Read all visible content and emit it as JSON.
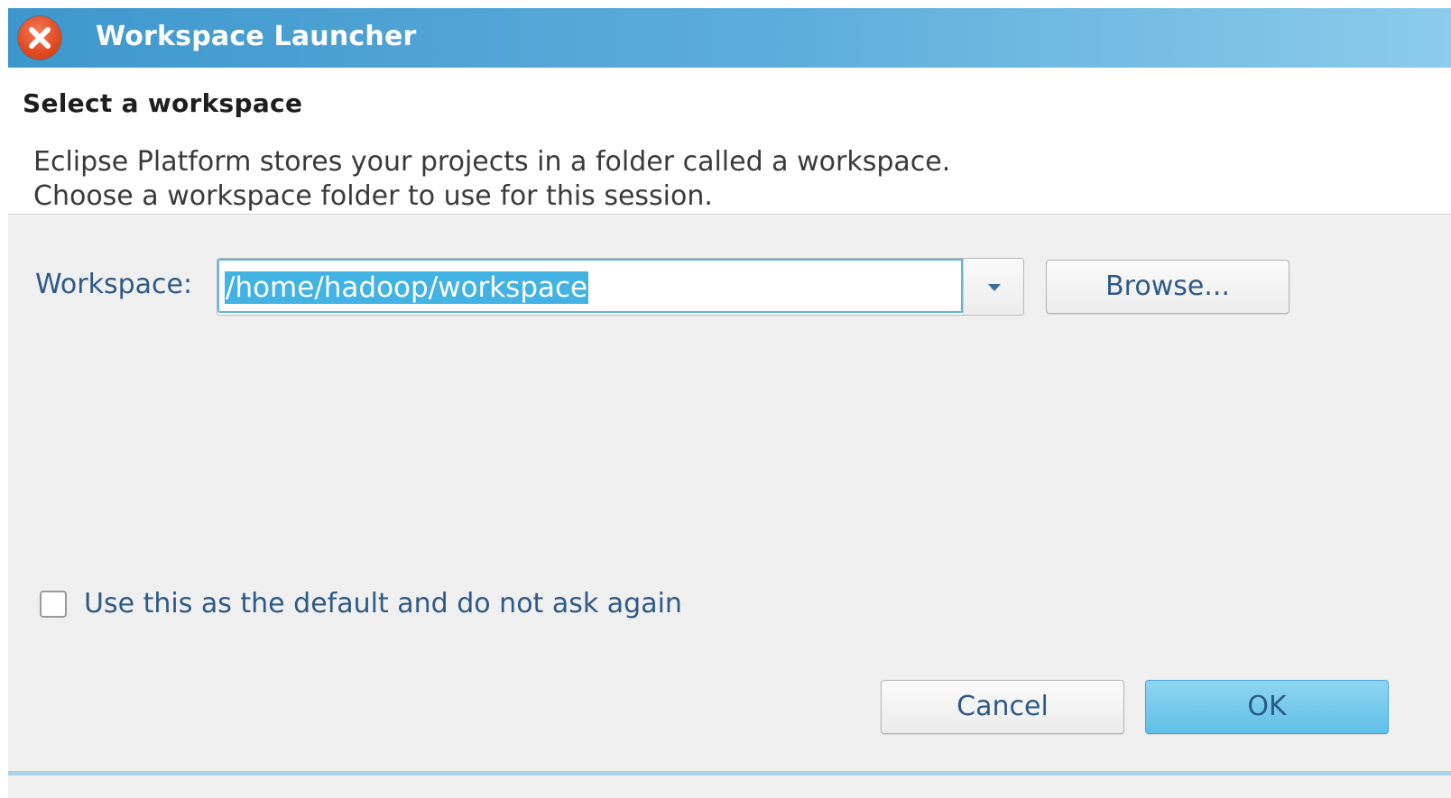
{
  "window": {
    "title": "Workspace Launcher",
    "close_icon": "close-icon",
    "title_bar_color": "#4aa0d4"
  },
  "header": {
    "title": "Select a workspace",
    "message_line1": "Eclipse Platform stores your projects in a folder called a workspace.",
    "message_line2": "Choose a workspace folder to use for this session."
  },
  "workspace": {
    "label": "Workspace:",
    "value": "/home/hadoop/workspace",
    "dropdown_icon": "chevron-down-icon",
    "browse_label": "Browse..."
  },
  "options": {
    "default_label": "Use this as the default and do not ask again",
    "default_checked": false
  },
  "buttons": {
    "cancel_label": "Cancel",
    "ok_label": "OK",
    "ok_color": "#6ec8ee"
  }
}
